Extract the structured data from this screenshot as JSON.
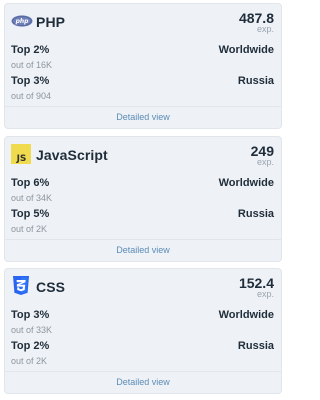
{
  "cards": [
    {
      "language": "PHP",
      "icon": "php-logo-icon",
      "score": "487.8",
      "score_unit": "exp.",
      "ranks": [
        {
          "title": "Top 2%",
          "sub": "out of 16K",
          "region": "Worldwide"
        },
        {
          "title": "Top 3%",
          "sub": "out of 904",
          "region": "Russia"
        }
      ],
      "detail_label": "Detailed view"
    },
    {
      "language": "JavaScript",
      "icon": "javascript-logo-icon",
      "score": "249",
      "score_unit": "exp.",
      "ranks": [
        {
          "title": "Top 6%",
          "sub": "out of 34K",
          "region": "Worldwide"
        },
        {
          "title": "Top 5%",
          "sub": "out of 2K",
          "region": "Russia"
        }
      ],
      "detail_label": "Detailed view"
    },
    {
      "language": "CSS",
      "icon": "css3-logo-icon",
      "score": "152.4",
      "score_unit": "exp.",
      "ranks": [
        {
          "title": "Top 3%",
          "sub": "out of 33K",
          "region": "Worldwide"
        },
        {
          "title": "Top 2%",
          "sub": "out of 2K",
          "region": "Russia"
        }
      ],
      "detail_label": "Detailed view"
    }
  ],
  "colors": {
    "card_bg": "#eef1f5",
    "text": "#1f2d3a",
    "muted": "#8c96a0",
    "link": "#5b8db8",
    "js_yellow": "#f0db4f",
    "css_blue": "#2965f1",
    "php_purple": "#6c7eb7"
  }
}
